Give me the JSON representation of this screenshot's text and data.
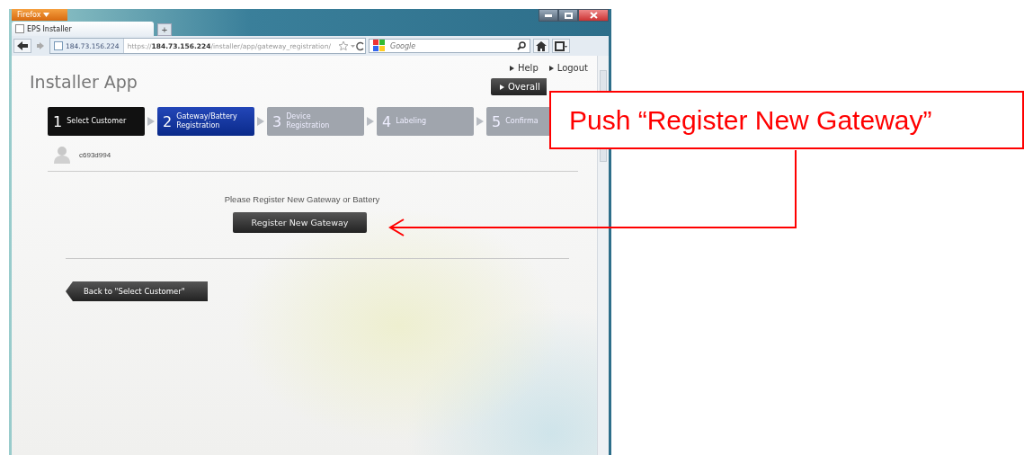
{
  "browser": {
    "menu_button": "Firefox",
    "tab_title": "EPS Installer",
    "new_tab": "+",
    "site_identity": "184.73.156.224",
    "url": {
      "scheme": "https://",
      "host": "184.73.156.224",
      "path": "/installer/app/gateway_registration/"
    },
    "search": {
      "placeholder": "Google"
    }
  },
  "app": {
    "title": "Installer App",
    "links": [
      "Help",
      "Logout"
    ],
    "overall_button": "Overall",
    "steps": [
      {
        "number": "1",
        "label": "Select Customer",
        "completed": true,
        "selected": false
      },
      {
        "number": "2",
        "label": "Gateway/Battery Registration",
        "completed": false,
        "selected": true
      },
      {
        "number": "3",
        "label": "Device Registration",
        "completed": false,
        "selected": false
      },
      {
        "number": "4",
        "label": "Labeling",
        "completed": false,
        "selected": false
      },
      {
        "number": "5",
        "label": "Confirma",
        "completed": false,
        "selected": false
      }
    ],
    "user": "c693d994",
    "message": "Please Register New Gateway or Battery",
    "primary_button": "Register New Gateway",
    "back_button": "Back to \"Select Customer\""
  },
  "annotation": {
    "text": "Push “Register New Gateway”"
  }
}
